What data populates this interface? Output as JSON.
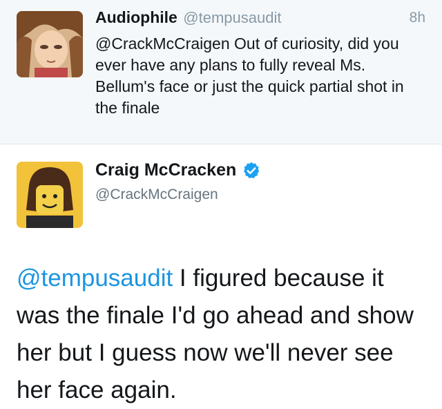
{
  "reply_tweet": {
    "name": "Audiophile",
    "handle": "@tempusaudit",
    "time": "8h",
    "mention": "@CrackMcCraigen",
    "text": " Out of curiosity, did you ever have any plans to fully reveal Ms. Bellum's face or just the quick partial shot in the finale"
  },
  "main_tweet": {
    "name": "Craig McCracken",
    "handle": "@CrackMcCraigen",
    "verified_icon": "verified-badge-icon",
    "mention": "@tempusaudit",
    "text": " I figured because it was the finale I'd go ahead and show her but I guess now we'll never see her face again."
  },
  "colors": {
    "mention_blue": "#1b95e0",
    "verified_blue": "#1da1f2",
    "secondary_text": "#8899a6"
  }
}
